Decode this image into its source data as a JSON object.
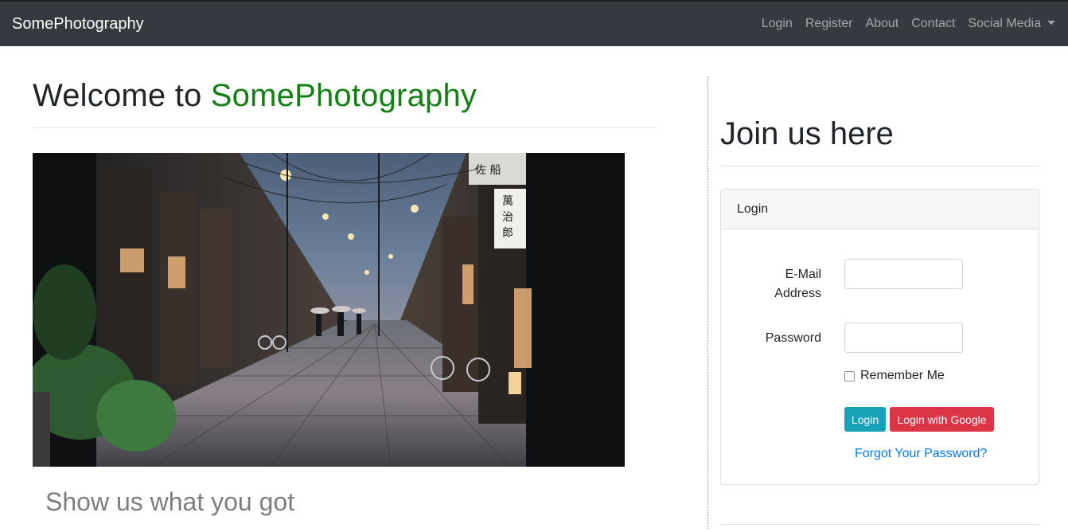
{
  "navbar": {
    "brand": "SomePhotography",
    "links": [
      "Login",
      "Register",
      "About",
      "Contact",
      "Social Media"
    ]
  },
  "hero": {
    "heading_prefix": "Welcome to",
    "heading_brand": "SomePhotography",
    "photo_alt": "Lantern-lit cobblestone street at dusk",
    "tagline": "Show us what you got"
  },
  "join": {
    "heading": "Join us here",
    "card_header": "Login",
    "email_label": "E-Mail Address",
    "email_value": "",
    "password_label": "Password",
    "password_value": "",
    "remember_label": "Remember Me",
    "login_button": "Login",
    "google_button": "Login with Google",
    "forgot_link": "Forgot Your Password?"
  },
  "colors": {
    "navbar_bg": "#343a40",
    "brand_green": "#128012",
    "login_button": "#17a2b8",
    "google_button": "#dc3545",
    "link": "#007bff"
  }
}
